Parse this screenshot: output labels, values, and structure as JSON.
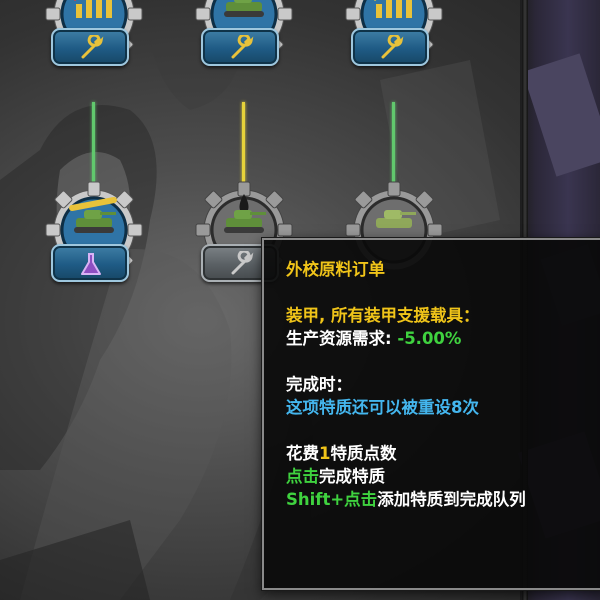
{
  "tooltip": {
    "title": "外校原料订单",
    "effect_header": "装甲, 所有装甲支援载具：",
    "effect_label": "生产资源需求: ",
    "effect_value": "-5.00%",
    "complete_label": "完成时：",
    "reset_text": "这项特质还可以被重设8次",
    "cost_prefix": "花费",
    "cost_value": "1",
    "cost_suffix": "特质点数",
    "click_hint": "点击",
    "click_action": "完成特质",
    "shift_hint": "Shift+点击",
    "shift_action": "添加特质到完成队列"
  },
  "nodes": [
    {
      "icon": "chart-up-icon",
      "slot_icon": "wrench-icon",
      "state": "completed"
    },
    {
      "icon": "tank-gear-icon",
      "slot_icon": "wrench-icon",
      "state": "completed"
    },
    {
      "icon": "chart-up-icon",
      "slot_icon": "wrench-icon",
      "state": "completed"
    },
    {
      "icon": "tank-wrench-icon",
      "slot_icon": "flask-icon",
      "state": "available"
    },
    {
      "icon": "tank-drop-icon",
      "slot_icon": "wrench-icon",
      "state": "locked"
    },
    {
      "icon": "tank-icon",
      "slot_icon": "none",
      "state": "locked"
    }
  ],
  "colors": {
    "gold": "#f0c419",
    "green": "#3fd23f",
    "cyan": "#44b6ee",
    "connector_green": "#61c86d",
    "connector_yellow": "#e6d23a"
  }
}
